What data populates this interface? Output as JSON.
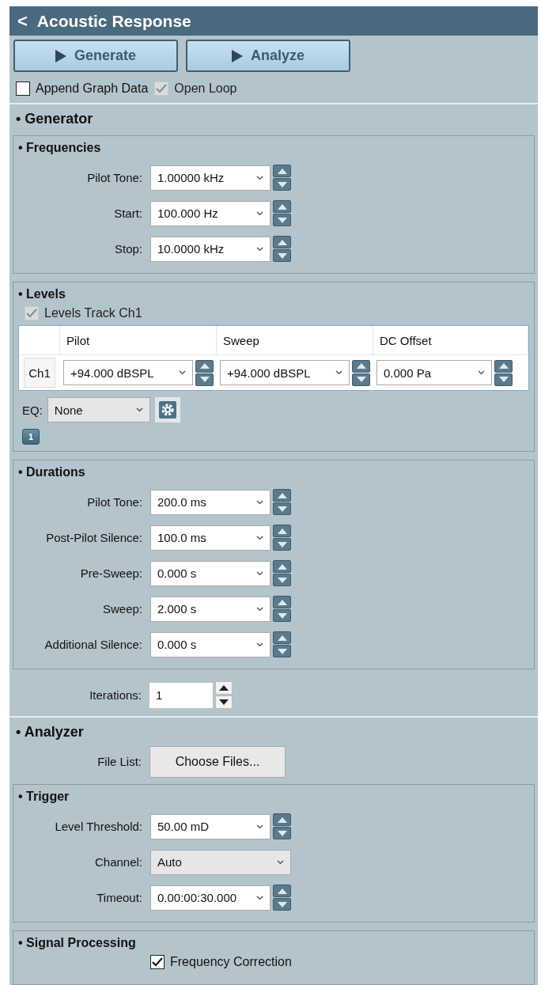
{
  "header": {
    "back": "<",
    "title": "Acoustic Response"
  },
  "actions": [
    {
      "label": "Generate"
    },
    {
      "label": "Analyze"
    }
  ],
  "options": [
    {
      "label": "Append Graph Data",
      "checked": false,
      "disabled": false
    },
    {
      "label": "Open Loop",
      "checked": true,
      "disabled": true
    }
  ],
  "generator": {
    "title": "• Generator",
    "frequencies": {
      "title": "• Frequencies",
      "rows": [
        {
          "label": "Pilot Tone:",
          "value": "1.00000 kHz",
          "kind": "spin"
        },
        {
          "label": "Start:",
          "value": "100.000 Hz",
          "kind": "spin"
        },
        {
          "label": "Stop:",
          "value": "10.0000 kHz",
          "kind": "spin"
        }
      ]
    },
    "levels": {
      "title": "• Levels",
      "track": {
        "label": "Levels Track Ch1",
        "checked": true,
        "disabled": true
      },
      "table": {
        "columns": [
          "Pilot",
          "Sweep",
          "DC Offset"
        ],
        "rows": [
          {
            "channel": "Ch1",
            "cells": [
              "+94.000 dBSPL",
              "+94.000 dBSPL",
              "0.000 Pa"
            ]
          }
        ]
      },
      "eq": {
        "label": "EQ:",
        "value": "None"
      },
      "page_badge": "1"
    },
    "durations": {
      "title": "• Durations",
      "rows": [
        {
          "label": "Pilot Tone:",
          "value": "200.0 ms",
          "kind": "spin"
        },
        {
          "label": "Post-Pilot Silence:",
          "value": "100.0 ms",
          "kind": "spin"
        },
        {
          "label": "Pre-Sweep:",
          "value": "0.000 s",
          "kind": "spin"
        },
        {
          "label": "Sweep:",
          "value": "2.000 s",
          "kind": "spin"
        },
        {
          "label": "Additional Silence:",
          "value": "0.000 s",
          "kind": "spin"
        }
      ]
    },
    "iterations": {
      "label": "Iterations:",
      "value": "1",
      "kind": "number"
    }
  },
  "analyzer": {
    "title": "• Analyzer",
    "file_list": {
      "label": "File List:",
      "button": "Choose Files..."
    },
    "trigger": {
      "title": "• Trigger",
      "rows": [
        {
          "label": "Level Threshold:",
          "value": "50.00 mD",
          "kind": "spin"
        },
        {
          "label": "Channel:",
          "value": "Auto",
          "kind": "combo"
        },
        {
          "label": "Timeout:",
          "value": "0.00:00:30.000",
          "kind": "spin"
        }
      ]
    },
    "signal_processing": {
      "title": "• Signal Processing",
      "options": [
        {
          "label": "Frequency Correction",
          "checked": true,
          "disabled": false
        }
      ]
    }
  }
}
